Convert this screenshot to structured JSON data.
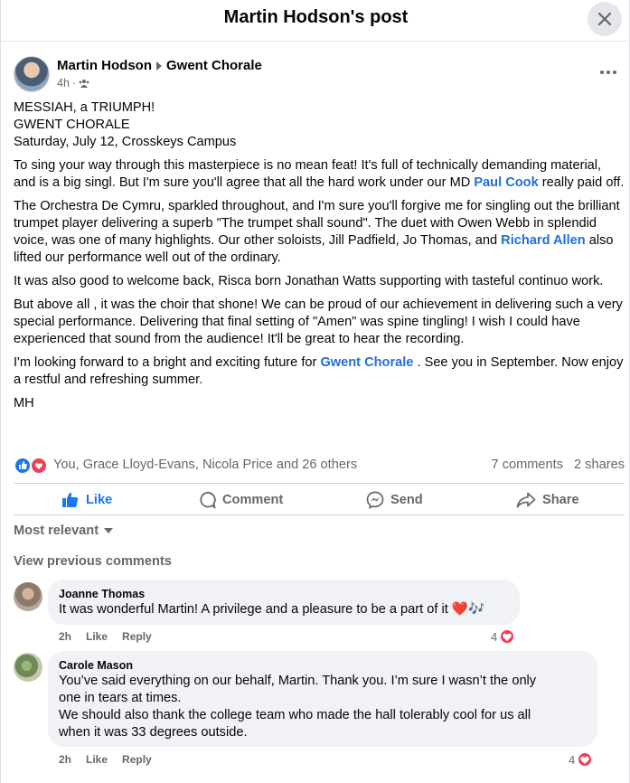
{
  "modal": {
    "title": "Martin Hodson's post"
  },
  "post": {
    "author": "Martin Hodson",
    "group": "Gwent Chorale",
    "time": "4h",
    "audience_icon": "group-icon",
    "headline": [
      "MESSIAH, a TRIUMPH!",
      "GWENT CHORALE",
      "Saturday, July 12, Crosskeys Campus"
    ],
    "p1_a": "To sing your way through this masterpiece is no mean feat! It's full of technically demanding material, and is a big singl. But I'm sure you'll agree that all the hard work under our MD ",
    "p1_link": "Paul Cook",
    "p1_b": " really paid off.",
    "p2_a": "The Orchestra De Cymru, sparkled throughout, and I'm sure you'll forgive me for singling out the brilliant trumpet player delivering a superb \"The trumpet shall sound\". The duet with Owen Webb in splendid voice, was one of many highlights. Our other soloists, Jill Padfield, Jo Thomas, and ",
    "p2_link": "Richard Allen",
    "p2_b": " also lifted our performance well out of the ordinary.",
    "p3": "It was also good to welcome back, Risca born Jonathan Watts supporting with tasteful continuo work.",
    "p4": "But above all , it was the choir that shone! We can be proud of our achievement in delivering such a very special performance. Delivering that final setting of \"Amen\" was spine tingling!  I wish I could have experienced that sound from the audience! It'll be great to hear the recording.",
    "p5_a": "I'm looking forward to a bright and exciting future for ",
    "p5_link": "Gwent Chorale",
    "p5_b": " . See you in September. Now enjoy a restful and refreshing summer.",
    "signoff": "MH"
  },
  "reactions": {
    "names": "You, Grace Lloyd-Evans, Nicola Price and 26 others",
    "comments": "7 comments",
    "shares": "2 shares"
  },
  "actions": {
    "like": "Like",
    "comment": "Comment",
    "send": "Send",
    "share": "Share"
  },
  "sort_label": "Most relevant",
  "view_previous": "View previous comments",
  "comments": [
    {
      "name": "Joanne Thomas",
      "text": "It was wonderful Martin! A privilege and a pleasure to be a part of it",
      "emoji": "❤️🎶",
      "time": "2h",
      "like": "Like",
      "reply": "Reply",
      "count": "4"
    },
    {
      "name": "Carole Mason",
      "lines": [
        "You’ve said everything on our behalf, Martin. Thank you. I’m sure I wasn’t the only",
        "one in tears at times.",
        "We should also thank the college team who made the hall tolerably cool for us all",
        "when it was 33 degrees outside."
      ],
      "time": "2h",
      "like": "Like",
      "reply": "Reply",
      "count": "4"
    }
  ],
  "colors": {
    "link": "#216fdb",
    "like_blue": "#1877f2",
    "heart_red": "#f33e58",
    "muted": "#65676b",
    "bubble": "#f0f2f5"
  }
}
